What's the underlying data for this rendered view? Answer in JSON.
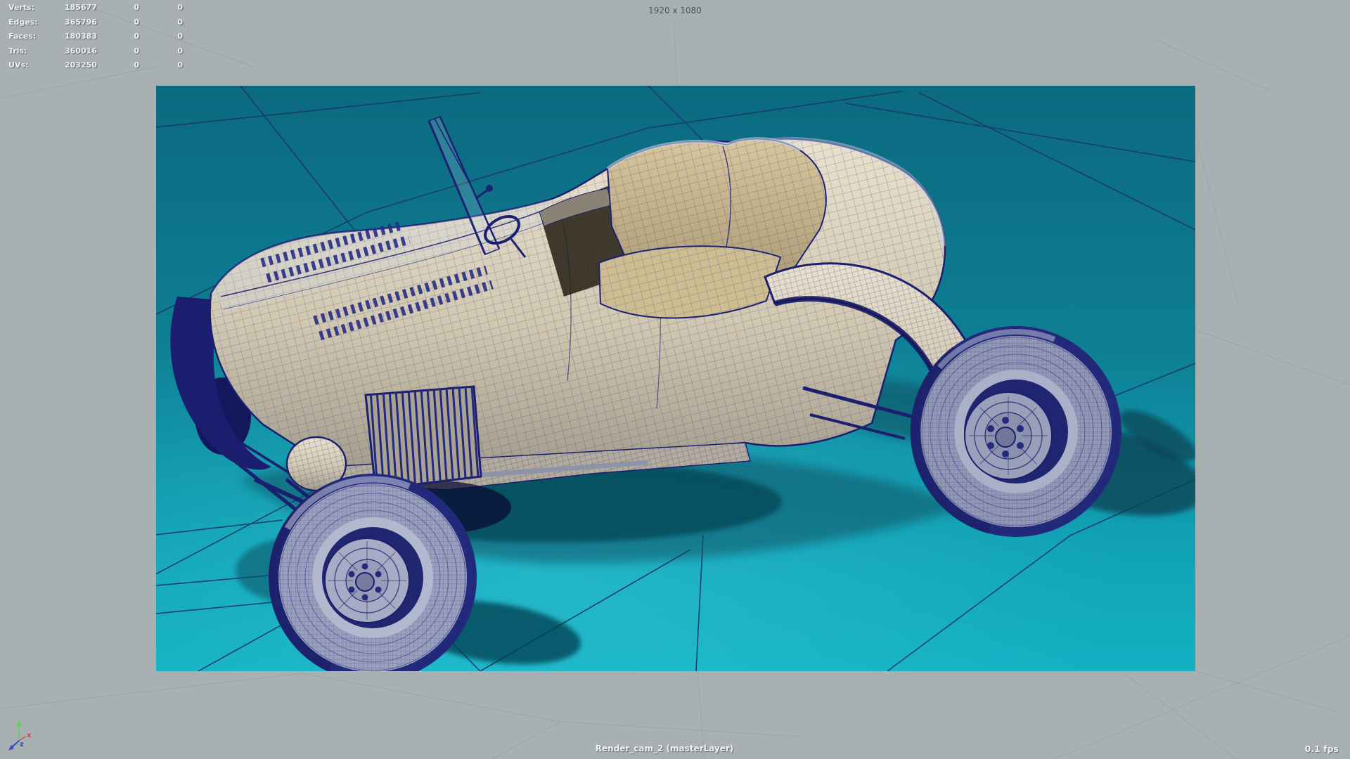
{
  "window": {
    "resolution_label": "1920 x 1080",
    "camera_label": "Render_cam_2 (masterLayer)",
    "fps_label": "0.1 fps"
  },
  "hud_stats": {
    "rows": [
      {
        "label": "Verts:",
        "value": "185677",
        "col2": "0",
        "col3": "0"
      },
      {
        "label": "Edges:",
        "value": "365796",
        "col2": "0",
        "col3": "0"
      },
      {
        "label": "Faces:",
        "value": "180383",
        "col2": "0",
        "col3": "0"
      },
      {
        "label": "Tris:",
        "value": "360016",
        "col2": "0",
        "col3": "0"
      },
      {
        "label": "UVs:",
        "value": "203250",
        "col2": "0",
        "col3": "0"
      }
    ]
  },
  "axis_gizmo": {
    "x_label": "x",
    "z_label": "z"
  },
  "scene": {
    "model": "wireframe roadster car",
    "colors": {
      "outside_gate_gray": "#a9b0b2",
      "ground_teal_top": "#0c6980",
      "ground_teal_bottom": "#14b0c3",
      "wireframe_navy": "#1d2270",
      "ground_line_navy": "#1a3a68",
      "body_beige": "#d8cdb4",
      "seat_tan": "#c9b488",
      "shadow_teal": "#073f51",
      "hud_text": "#eef2f2",
      "resolution_text": "#4e5556"
    }
  }
}
